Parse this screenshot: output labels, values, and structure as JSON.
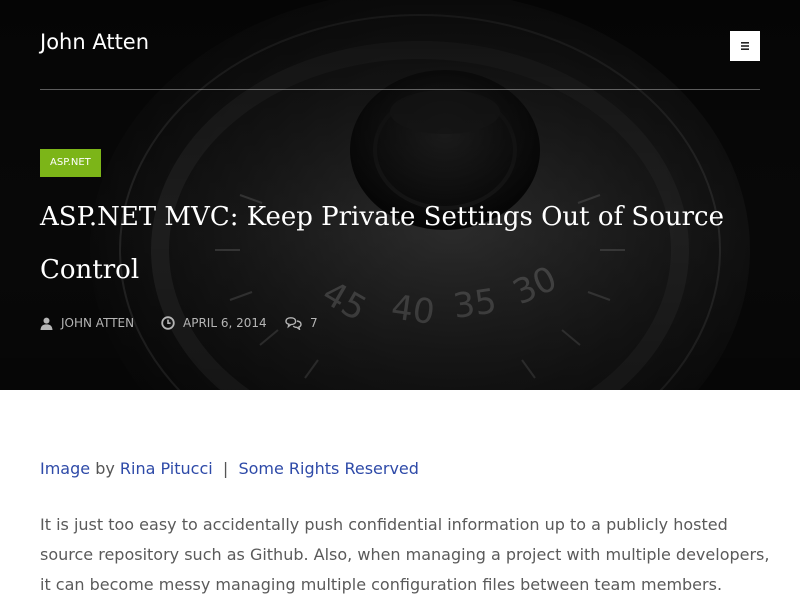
{
  "header": {
    "site_title": "John Atten",
    "menu_icon": "hamburger-icon"
  },
  "post": {
    "category": "ASP.NET",
    "title": "ASP.NET MVC: Keep Private Settings Out of Source Control",
    "author": "JOHN ATTEN",
    "date": "APRIL 6, 2014",
    "comment_count": "7"
  },
  "content": {
    "credit": {
      "image_link": "Image",
      "by_text": " by ",
      "author_link": "Rina Pitucci",
      "separator": "  |  ",
      "rights_link": "Some Rights Reserved"
    },
    "intro": "It is just too easy to accidentally push confidential information up to a publicly hosted source repository such as Github. Also, when managing a project with multiple developers, it can become messy managing multiple configuration files between team members."
  },
  "colors": {
    "badge": "#7cb518",
    "link": "#2e4aa8",
    "hero_bg": "#0b0b0b"
  },
  "hero_image": "combination-lock-dial"
}
